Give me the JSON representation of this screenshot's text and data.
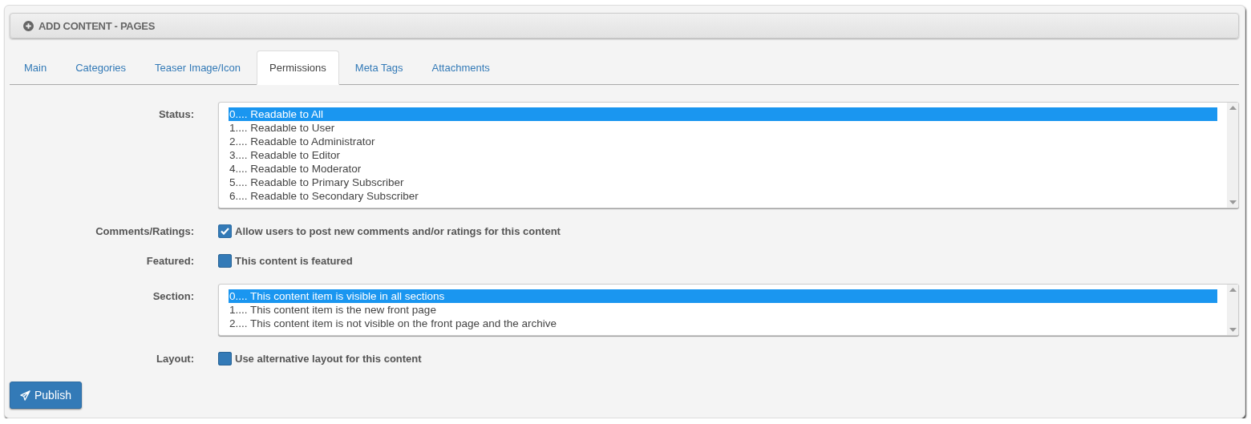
{
  "header": {
    "title": "ADD CONTENT - PAGES"
  },
  "tabs": [
    {
      "label": "Main",
      "selected": false
    },
    {
      "label": "Categories",
      "selected": false
    },
    {
      "label": "Teaser Image/Icon",
      "selected": false
    },
    {
      "label": "Permissions",
      "selected": true
    },
    {
      "label": "Meta Tags",
      "selected": false
    },
    {
      "label": "Attachments",
      "selected": false
    }
  ],
  "fields": [
    {
      "kind": "listbox",
      "label": "Status:",
      "options": [
        {
          "text": "0.... Readable to All",
          "selected": true
        },
        {
          "text": "1.... Readable to User",
          "selected": false
        },
        {
          "text": "2.... Readable to Administrator",
          "selected": false
        },
        {
          "text": "3.... Readable to Editor",
          "selected": false
        },
        {
          "text": "4.... Readable to Moderator",
          "selected": false
        },
        {
          "text": "5.... Readable to Primary Subscriber",
          "selected": false
        },
        {
          "text": "6.... Readable to Secondary Subscriber",
          "selected": false
        }
      ]
    },
    {
      "kind": "checkbox",
      "label": "Comments/Ratings:",
      "text": "Allow users to post new comments and/or ratings for this content",
      "checked": true
    },
    {
      "kind": "checkbox",
      "label": "Featured:",
      "text": "This content is featured",
      "checked": false
    },
    {
      "kind": "listbox",
      "label": "Section:",
      "options": [
        {
          "text": "0.... This content item is visible in all sections",
          "selected": true
        },
        {
          "text": "1.... This content item is the new front page",
          "selected": false
        },
        {
          "text": "2.... This content item is not visible on the front page and the archive",
          "selected": false
        }
      ]
    },
    {
      "kind": "checkbox",
      "label": "Layout:",
      "text": "Use alternative layout for this content",
      "checked": false
    }
  ],
  "buttons": [
    {
      "label": "Publish"
    }
  ]
}
